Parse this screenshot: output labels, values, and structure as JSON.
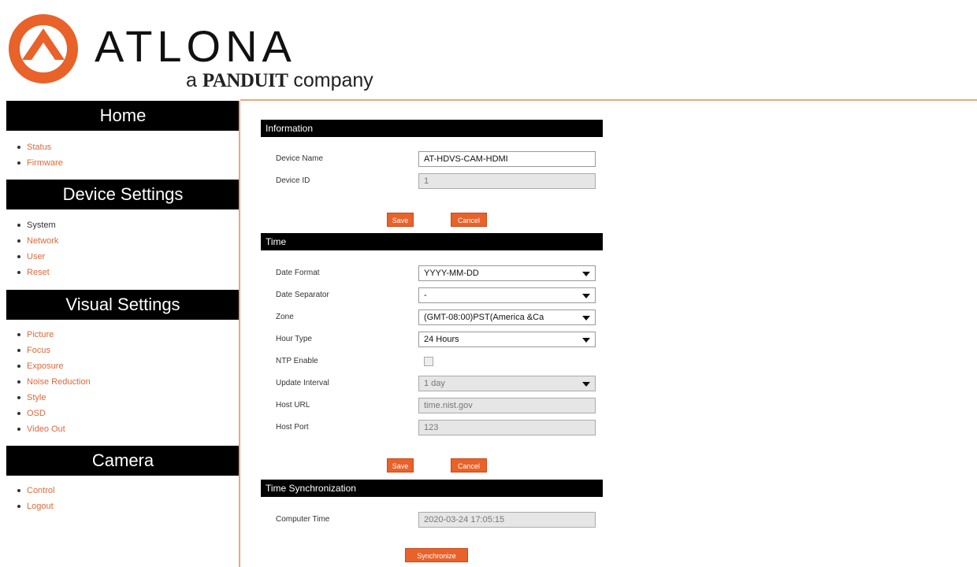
{
  "brand": {
    "name": "ATLONA",
    "tagline_pre": "a ",
    "tagline_mark": "PANDUIT",
    "tagline_post": " company"
  },
  "colors": {
    "accent": "#e8622a",
    "link": "#e0683a",
    "divider": "#e8a87c"
  },
  "sidebar": {
    "home": {
      "title": "Home",
      "items": [
        "Status",
        "Firmware"
      ]
    },
    "device": {
      "title": "Device Settings",
      "items": [
        "System",
        "Network",
        "User",
        "Reset"
      ]
    },
    "visual": {
      "title": "Visual Settings",
      "items": [
        "Picture",
        "Focus",
        "Exposure",
        "Noise Reduction",
        "Style",
        "OSD",
        "Video Out"
      ]
    },
    "camera": {
      "title": "Camera",
      "items": [
        "Control",
        "Logout"
      ]
    }
  },
  "information": {
    "title": "Information",
    "device_name_label": "Device Name",
    "device_name_value": "AT-HDVS-CAM-HDMI",
    "device_id_label": "Device ID",
    "device_id_value": "1",
    "save": "Save",
    "cancel": "Cancel"
  },
  "time": {
    "title": "Time",
    "date_format_label": "Date Format",
    "date_format_value": "YYYY-MM-DD",
    "date_separator_label": "Date Separator",
    "date_separator_value": "-",
    "zone_label": "Zone",
    "zone_value": "(GMT-08:00)PST(America &Ca",
    "hour_type_label": "Hour Type",
    "hour_type_value": "24 Hours",
    "ntp_label": "NTP Enable",
    "update_interval_label": "Update Interval",
    "update_interval_value": "1 day",
    "host_url_label": "Host URL",
    "host_url_value": "time.nist.gov",
    "host_port_label": "Host Port",
    "host_port_value": "123",
    "save": "Save",
    "cancel": "Cancel"
  },
  "sync": {
    "title": "Time Synchronization",
    "computer_time_label": "Computer Time",
    "computer_time_value": "2020-03-24 17:05:15",
    "button": "Synchronize"
  }
}
